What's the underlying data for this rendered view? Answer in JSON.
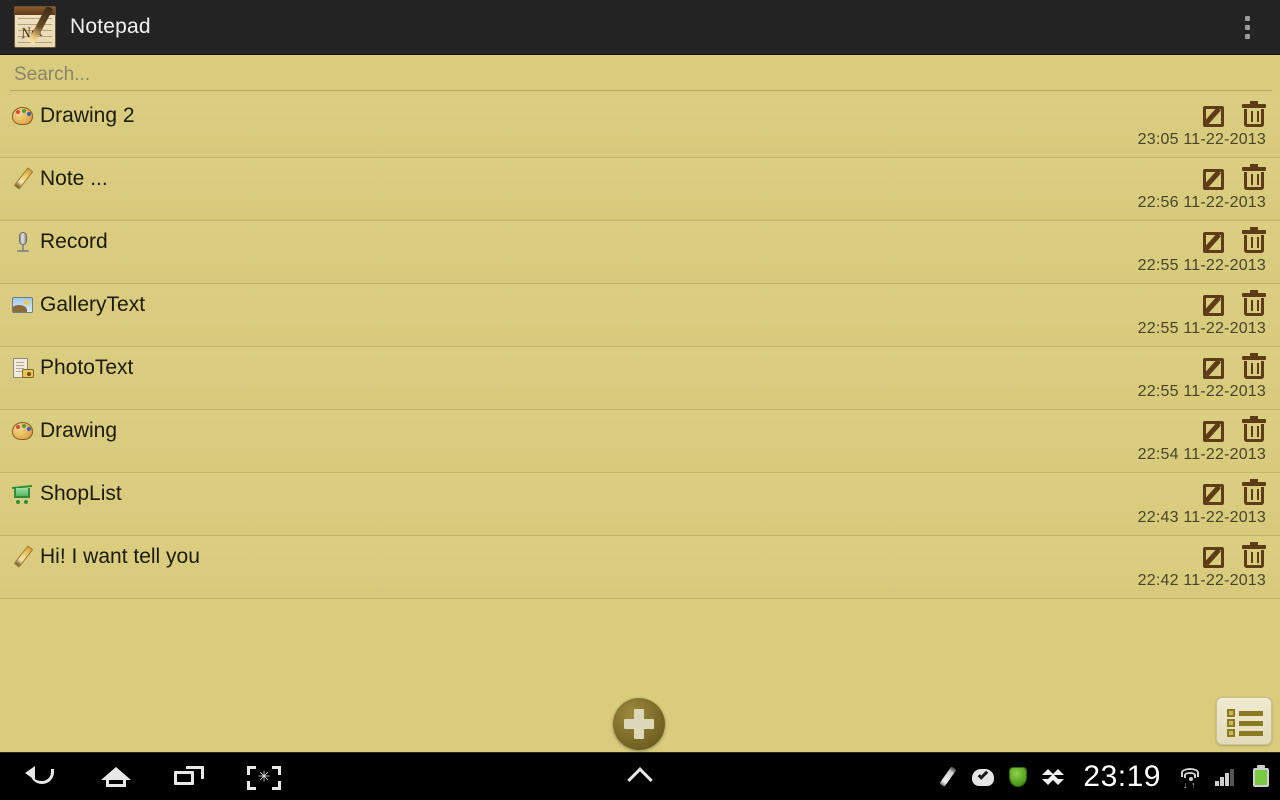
{
  "app": {
    "title": "Notepad",
    "icon": "notepad-pen-icon",
    "overflow_menu": "overflow-menu-icon",
    "accent_background": "#d9cc7d",
    "titlebar_color": "#232323",
    "action_icon_color": "#5c3d17"
  },
  "search": {
    "placeholder": "Search...",
    "value": ""
  },
  "notes": [
    {
      "icon": "palette-icon",
      "title": "Drawing 2",
      "date": "23:05 11-22-2013",
      "edit_label": "edit-note-icon",
      "delete_label": "delete-note-icon"
    },
    {
      "icon": "pencil-icon",
      "title": "Note ...",
      "date": "22:56 11-22-2013",
      "edit_label": "edit-note-icon",
      "delete_label": "delete-note-icon"
    },
    {
      "icon": "mic-icon",
      "title": "Record",
      "date": "22:55 11-22-2013",
      "edit_label": "edit-note-icon",
      "delete_label": "delete-note-icon"
    },
    {
      "icon": "gallery-icon",
      "title": "GalleryText",
      "date": "22:55 11-22-2013",
      "edit_label": "edit-note-icon",
      "delete_label": "delete-note-icon"
    },
    {
      "icon": "photo-icon",
      "title": "PhotoText",
      "date": "22:55 11-22-2013",
      "edit_label": "edit-note-icon",
      "delete_label": "delete-note-icon"
    },
    {
      "icon": "palette-icon",
      "title": "Drawing",
      "date": "22:54 11-22-2013",
      "edit_label": "edit-note-icon",
      "delete_label": "delete-note-icon"
    },
    {
      "icon": "cart-icon",
      "title": "ShopList",
      "date": "22:43 11-22-2013",
      "edit_label": "edit-note-icon",
      "delete_label": "delete-note-icon"
    },
    {
      "icon": "pencil-icon",
      "title": "Hi! I want tell you",
      "date": "22:42 11-22-2013",
      "edit_label": "edit-note-icon",
      "delete_label": "delete-note-icon"
    }
  ],
  "bottom": {
    "add_button": "add-note-button",
    "list_view_button": "list-view-button"
  },
  "navbar": {
    "back": "back-icon",
    "home": "home-icon",
    "recents": "recent-apps-icon",
    "screenshot": "screenshot-icon",
    "expand": "expand-up-icon"
  },
  "statusbar": {
    "clock": "23:19",
    "icons": [
      "pencil-notification-icon",
      "cloud-check-icon",
      "shield-icon",
      "dropbox-icon",
      "wifi-icon",
      "signal-icon",
      "battery-icon"
    ]
  }
}
